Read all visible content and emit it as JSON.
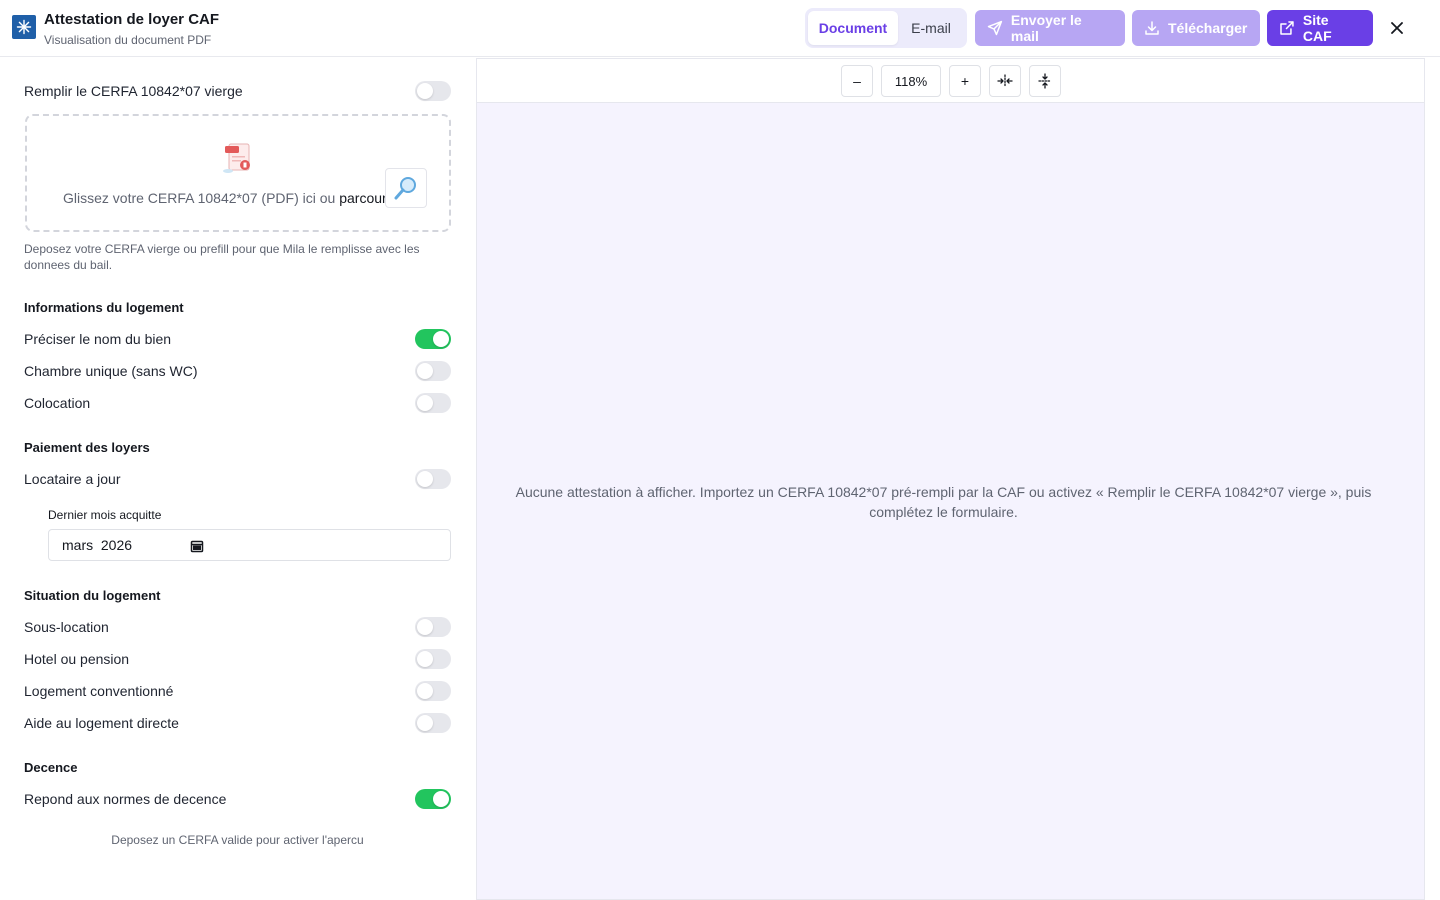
{
  "header": {
    "title": "Attestation de loyer CAF",
    "subtitle": "Visualisation du document PDF",
    "tabs": [
      {
        "label": "Document",
        "active": true
      },
      {
        "label": "E-mail",
        "active": false
      }
    ],
    "send_label": "Envoyer le mail",
    "download_label": "Télécharger",
    "caf_label": "Site CAF"
  },
  "form": {
    "blank_cerfa": {
      "label": "Remplir le CERFA 10842*07 vierge",
      "on": false
    },
    "dropzone": {
      "text": "Glissez votre CERFA 10842*07 (PDF) ici ou ",
      "link": "parcourir"
    },
    "helper": "Deposez votre CERFA vierge ou prefill pour que Mila le remplisse avec les donnees du bail.",
    "logement": {
      "title": "Informations du logement",
      "items": [
        {
          "label": "Préciser le nom du bien",
          "on": true
        },
        {
          "label": "Chambre unique (sans WC)",
          "on": false
        },
        {
          "label": "Colocation",
          "on": false
        }
      ]
    },
    "paiement": {
      "title": "Paiement des loyers",
      "items": [
        {
          "label": "Locataire a jour",
          "on": false
        }
      ],
      "date_label": "Dernier mois acquitte",
      "date_value": "mars  2026"
    },
    "situation": {
      "title": "Situation du logement",
      "items": [
        {
          "label": "Sous-location",
          "on": false
        },
        {
          "label": "Hotel ou pension",
          "on": false
        },
        {
          "label": "Logement conventionné",
          "on": false
        },
        {
          "label": "Aide au logement directe",
          "on": false
        }
      ]
    },
    "decence": {
      "title": "Decence",
      "items": [
        {
          "label": "Repond aux normes de decence",
          "on": true
        }
      ]
    },
    "footer_note": "Deposez un CERFA valide pour activer l'apercu"
  },
  "viewer": {
    "zoom": "118%",
    "zoom_out": "–",
    "zoom_in": "+",
    "empty_message": "Aucune attestation à afficher. Importez un CERFA 10842*07 pré-rempli par la CAF ou activez « Remplir le CERFA 10842*07 vierge », puis complétez le formulaire."
  },
  "colors": {
    "accent": "#6a3fe6",
    "accent_disabled": "#b7a6f3",
    "toggle_on": "#22c55e",
    "toggle_off": "#e6e7ec",
    "viewer_bg": "#f5f3fe"
  }
}
